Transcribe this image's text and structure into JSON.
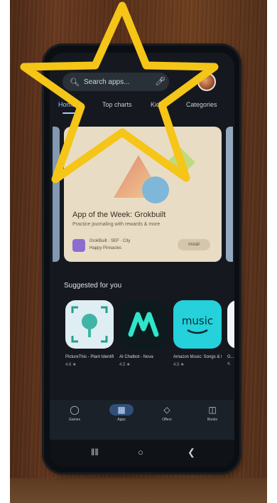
{
  "search": {
    "placeholder": "Search apps...",
    "icon": "search-icon",
    "mic_icon": "mic-icon"
  },
  "tabs": [
    {
      "label": "Home",
      "active": true
    },
    {
      "label": "Top charts",
      "active": false
    },
    {
      "label": "Kids",
      "active": false
    },
    {
      "label": "Categories",
      "active": false
    }
  ],
  "feature_card": {
    "title": "App of the Week: Grokbuilt",
    "subtitle": "Practice journaling with rewards & more",
    "app_name": "GrokBuilt · SEF · City",
    "app_meta": "Happy Pinnacles",
    "button": "Install"
  },
  "section": {
    "title": "Suggested for you"
  },
  "apps": [
    {
      "name": "PictureThis - Plant Identifier",
      "rating": "4.6 ★",
      "color": "#dfeef3"
    },
    {
      "name": "AI Chatbot - Nova",
      "rating": "4.5 ★",
      "color": "#0f1a1f"
    },
    {
      "name": "Amazon Music: Songs & Podcasts",
      "rating": "4.5 ★",
      "color": "#25d1da"
    },
    {
      "name": "G...",
      "rating": "4.",
      "color": "#f2f4f7"
    }
  ],
  "bottom_nav": [
    {
      "label": "Games",
      "icon": "gamepad-icon",
      "active": false
    },
    {
      "label": "Apps",
      "icon": "apps-grid-icon",
      "active": true
    },
    {
      "label": "Offers",
      "icon": "tag-icon",
      "active": false
    },
    {
      "label": "Books",
      "icon": "book-icon",
      "active": false
    }
  ],
  "colors": {
    "star": "#f5c518",
    "screen_bg": "#15191f",
    "accent": "#a8c7fa",
    "card_bg": "#e9dcc4"
  }
}
